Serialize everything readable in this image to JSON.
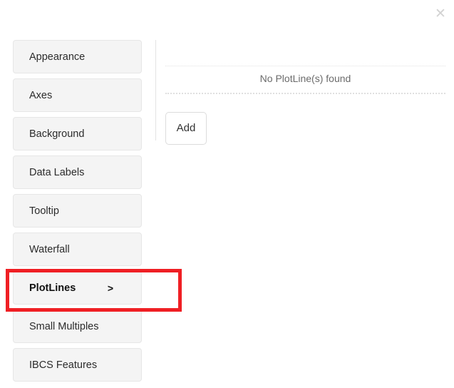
{
  "dialog": {
    "close_icon": "close-icon",
    "close_glyph": "✕"
  },
  "sidebar": {
    "items": [
      {
        "label": "Appearance",
        "active": false,
        "chevron": ""
      },
      {
        "label": "Axes",
        "active": false,
        "chevron": ""
      },
      {
        "label": "Background",
        "active": false,
        "chevron": ""
      },
      {
        "label": "Data Labels",
        "active": false,
        "chevron": ""
      },
      {
        "label": "Tooltip",
        "active": false,
        "chevron": ""
      },
      {
        "label": "Waterfall",
        "active": false,
        "chevron": ""
      },
      {
        "label": "PlotLines",
        "active": true,
        "chevron": ">"
      },
      {
        "label": "Small Multiples",
        "active": false,
        "chevron": ""
      },
      {
        "label": "IBCS Features",
        "active": false,
        "chevron": ""
      }
    ]
  },
  "content": {
    "empty_message": "No PlotLine(s) found",
    "add_label": "Add"
  },
  "annotation": {
    "highlight_color": "#ef1f24",
    "highlight_target": "PlotLines"
  },
  "colors": {
    "nav_background": "#f4f4f4",
    "nav_border": "#e6e6e6",
    "panel_background": "#ffffff",
    "divider": "#e3e3e3",
    "muted_text": "#6b6b6b"
  }
}
